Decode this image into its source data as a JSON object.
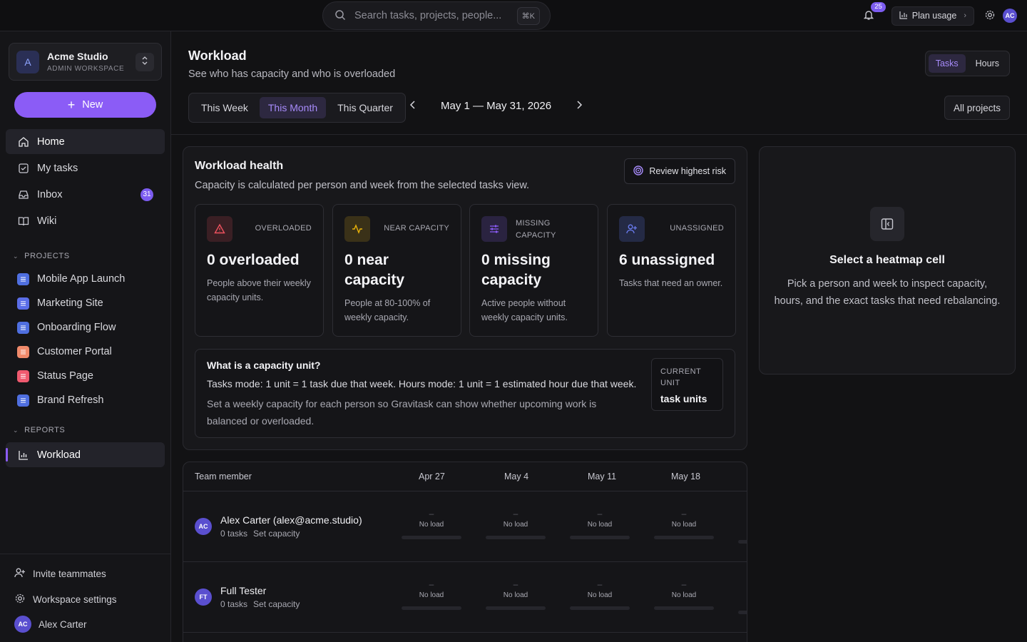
{
  "topbar": {
    "search_placeholder": "Search tasks, projects, people...",
    "search_shortcut": "⌘K",
    "notification_count": "25",
    "plan_usage_label": "Plan usage",
    "user_initials": "AC"
  },
  "workspace": {
    "initial": "A",
    "name": "Acme Studio",
    "role": "ADMIN WORKSPACE"
  },
  "sidebar": {
    "new_label": "New",
    "nav": [
      {
        "label": "Home",
        "icon": "home-icon"
      },
      {
        "label": "My tasks",
        "icon": "checkbox-icon"
      },
      {
        "label": "Inbox",
        "icon": "inbox-icon",
        "badge": "31"
      },
      {
        "label": "Wiki",
        "icon": "book-icon"
      }
    ],
    "projects_heading": "PROJECTS",
    "projects": [
      {
        "label": "Mobile App Launch",
        "color": "#4f6fe0"
      },
      {
        "label": "Marketing Site",
        "color": "#5b6ee8"
      },
      {
        "label": "Onboarding Flow",
        "color": "#4f6fe0"
      },
      {
        "label": "Customer Portal",
        "color": "#f08a6b"
      },
      {
        "label": "Status Page",
        "color": "#ef5a6f"
      },
      {
        "label": "Brand Refresh",
        "color": "#4f6fe0"
      }
    ],
    "reports_heading": "REPORTS",
    "reports": [
      {
        "label": "Workload"
      }
    ],
    "footer": {
      "invite": "Invite teammates",
      "settings": "Workspace settings",
      "user_initials": "AC",
      "user_name": "Alex Carter"
    }
  },
  "page": {
    "title": "Workload",
    "subtitle": "See who has capacity and who is overloaded",
    "modes": [
      "Tasks",
      "Hours"
    ],
    "active_mode": "Tasks",
    "ranges": [
      "This Week",
      "This Month",
      "This Quarter"
    ],
    "active_range": "This Month",
    "date_range": "May 1 — May 31, 2026",
    "project_filter": "All projects"
  },
  "health": {
    "title": "Workload health",
    "subtitle": "Capacity is calculated per person and week from the selected tasks view.",
    "risk_button": "Review highest risk",
    "kpis": [
      {
        "label": "OVERLOADED",
        "value": "0 overloaded",
        "desc": "People above their weekly capacity units.",
        "color": "#f0525f"
      },
      {
        "label": "NEAR CAPACITY",
        "value": "0 near capacity",
        "desc": "People at 80-100% of weekly capacity.",
        "color": "#eab308"
      },
      {
        "label": "MISSING CAPACITY",
        "value": "0 missing capacity",
        "desc": "Active people without weekly capacity units.",
        "color": "#8b5cf6"
      },
      {
        "label": "UNASSIGNED",
        "value": "6 unassigned",
        "desc": "Tasks that need an owner.",
        "color": "#6a7cf0"
      }
    ],
    "unit_title": "What is a capacity unit?",
    "unit_line": "Tasks mode: 1 unit = 1 task due that week. Hours mode: 1 unit = 1 estimated hour due that week.",
    "unit_note": "Set a weekly capacity for each person so Gravitask can show whether upcoming work is balanced or overloaded.",
    "current_unit_label": "CURRENT UNIT",
    "current_unit_value": "task units"
  },
  "side_panel": {
    "title": "Select a heatmap cell",
    "desc": "Pick a person and week to inspect capacity, hours, and the exact tasks that need rebalancing."
  },
  "heatmap": {
    "member_header": "Team member",
    "weeks": [
      "Apr 27",
      "May 4",
      "May 11",
      "May 18"
    ],
    "rows": [
      {
        "initials": "AC",
        "name": "Alex Carter (alex@acme.studio)",
        "tasks": "0 tasks",
        "action": "Set capacity",
        "cells": [
          {
            "dash": "–",
            "label": "No load"
          },
          {
            "dash": "–",
            "label": "No load"
          },
          {
            "dash": "–",
            "label": "No load"
          },
          {
            "dash": "–",
            "label": "No load"
          }
        ]
      },
      {
        "initials": "FT",
        "name": "Full Tester",
        "tasks": "0 tasks",
        "action": "Set capacity",
        "cells": [
          {
            "dash": "–",
            "label": "No load"
          },
          {
            "dash": "–",
            "label": "No load"
          },
          {
            "dash": "–",
            "label": "No load"
          },
          {
            "dash": "–",
            "label": "No load"
          }
        ]
      }
    ]
  }
}
